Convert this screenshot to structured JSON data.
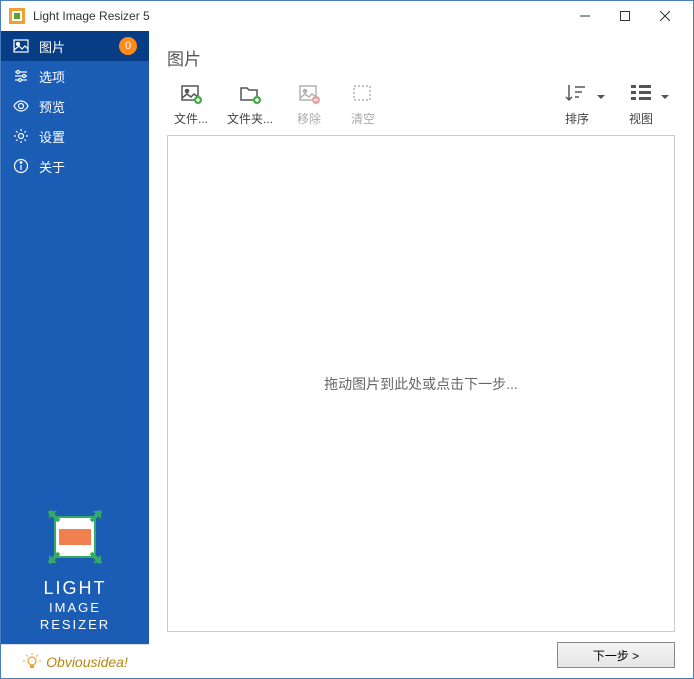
{
  "window": {
    "title": "Light Image Resizer 5"
  },
  "sidebar": {
    "items": [
      {
        "label": "图片",
        "icon": "image-icon",
        "active": true,
        "badge": "0"
      },
      {
        "label": "选项",
        "icon": "sliders-icon"
      },
      {
        "label": "预览",
        "icon": "eye-icon"
      },
      {
        "label": "设置",
        "icon": "gear-icon"
      },
      {
        "label": "关于",
        "icon": "info-icon"
      }
    ],
    "brand": {
      "line1": "LIGHT",
      "line2": "IMAGE",
      "line3": "RESIZER"
    },
    "vendor": "Obviousidea!"
  },
  "main": {
    "title": "图片",
    "tools": {
      "file": "文件...",
      "folder": "文件夹...",
      "remove": "移除",
      "clear": "清空",
      "sort": "排序",
      "view": "视图"
    },
    "canvas_placeholder": "拖动图片到此处或点击下一步...",
    "next": "下一步  >"
  }
}
